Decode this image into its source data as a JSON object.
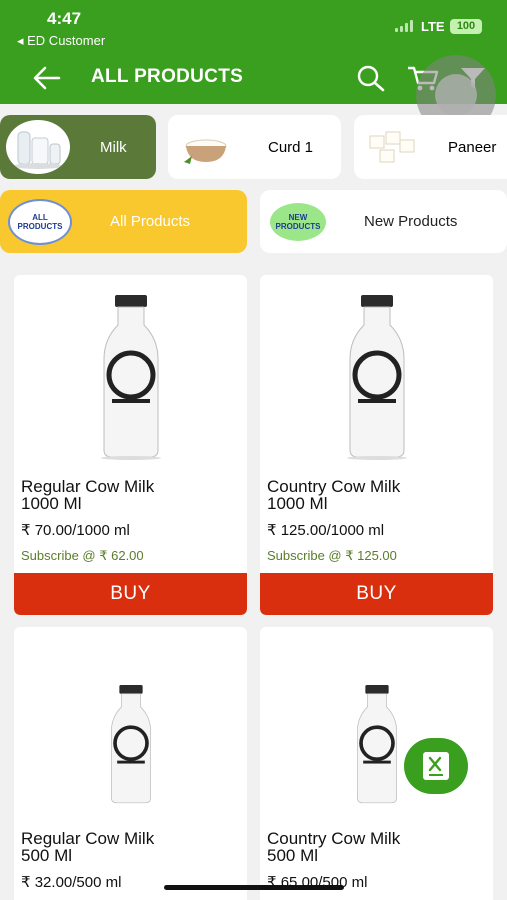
{
  "status": {
    "time": "4:47",
    "back_app": "◂ ED Customer",
    "network": "LTE",
    "battery": "100"
  },
  "header": {
    "title": "ALL PRODUCTS"
  },
  "categories": [
    {
      "label": "Milk",
      "active": true
    },
    {
      "label": "Curd 1",
      "active": false
    },
    {
      "label": "Paneer",
      "active": false
    }
  ],
  "filters": [
    {
      "badge_line1": "ALL",
      "badge_line2": "PRODUCTS",
      "label": "All Products",
      "active": true
    },
    {
      "badge_line1": "NEW",
      "badge_line2": "PRODUCTS",
      "label": "New Products",
      "active": false
    }
  ],
  "products": [
    {
      "name": "Regular Cow Milk 1000 Ml",
      "price": "₹ 70.00/1000 ml",
      "subscribe": "Subscribe @ ₹ 62.00",
      "buy": "BUY"
    },
    {
      "name": "Country Cow Milk 1000 Ml",
      "price": "₹ 125.00/1000 ml",
      "subscribe": "Subscribe @ ₹ 125.00",
      "buy": "BUY"
    },
    {
      "name": "Regular Cow Milk 500 Ml",
      "price": "₹ 32.00/500 ml"
    },
    {
      "name": "Country Cow Milk 500 Ml",
      "price": "₹ 65.00/500 ml"
    }
  ],
  "colors": {
    "brand_green": "#3a9f1f",
    "buy_red": "#d92f0e",
    "active_category": "#5b7a3a",
    "active_filter": "#f9c72e"
  },
  "icons": [
    "back-arrow-icon",
    "search-icon",
    "cart-icon",
    "filter-icon",
    "menu-fab-icon"
  ]
}
